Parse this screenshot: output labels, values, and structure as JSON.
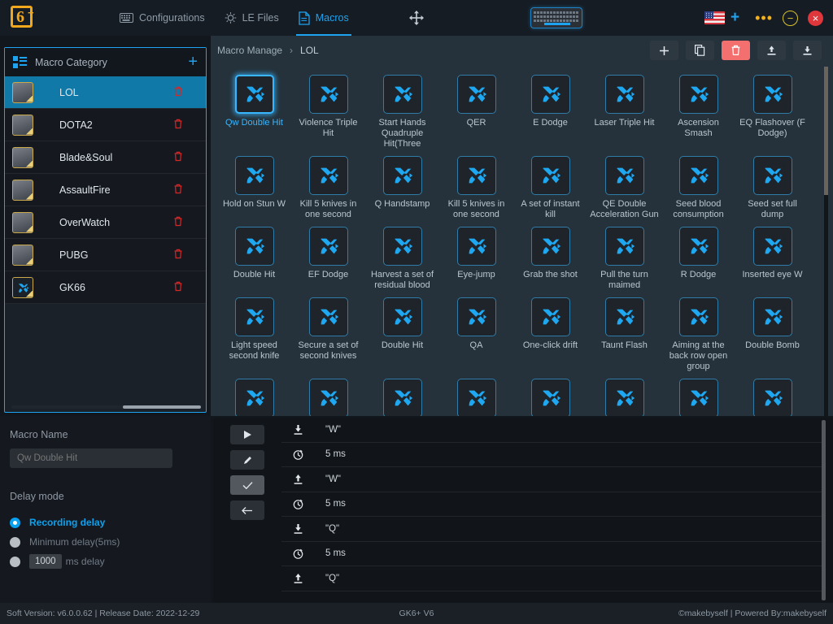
{
  "header": {
    "logo": "6+",
    "nav": [
      {
        "label": "Configurations",
        "icon": "keyboard-icon",
        "active": false
      },
      {
        "label": "LE Files",
        "icon": "lightbulb-icon",
        "active": false
      },
      {
        "label": "Macros",
        "icon": "document-icon",
        "active": true
      }
    ],
    "move_icon": "move-icon",
    "device_icon": "keyboard-device-icon",
    "language_flag": "us-flag-icon",
    "add_language": "+",
    "more_icon": "more-dots-icon",
    "minimize": "−",
    "close": "×",
    "accent_color": "#1ea3f0",
    "logo_color": "#f2a81d"
  },
  "sidebar": {
    "title": "Macro Category",
    "add_label": "+",
    "items": [
      {
        "label": "LOL",
        "selected": true
      },
      {
        "label": "DOTA2",
        "selected": false
      },
      {
        "label": "Blade&Soul",
        "selected": false
      },
      {
        "label": "AssaultFire",
        "selected": false
      },
      {
        "label": "OverWatch",
        "selected": false
      },
      {
        "label": "PUBG",
        "selected": false
      },
      {
        "label": "GK66",
        "selected": false
      }
    ]
  },
  "properties": {
    "macro_name_label": "Macro Name",
    "macro_name_value": "Qw Double Hit",
    "delay_mode_label": "Delay mode",
    "options": [
      {
        "label": "Recording delay",
        "selected": true
      },
      {
        "label": "Minimum delay(5ms)",
        "selected": false
      },
      {
        "label": "ms delay",
        "value": "1000",
        "selected": false
      }
    ]
  },
  "main": {
    "breadcrumb": {
      "root": "Macro Manage",
      "separator": "›",
      "current": "LOL"
    },
    "toolbar": [
      {
        "name": "add-macro-button",
        "glyph": "+",
        "danger": false
      },
      {
        "name": "copy-macro-button",
        "glyph": "❐",
        "danger": false
      },
      {
        "name": "delete-macro-button",
        "glyph": "🗑",
        "danger": true
      },
      {
        "name": "import-macro-button",
        "glyph": "↑",
        "danger": false
      },
      {
        "name": "export-macro-button",
        "glyph": "↓",
        "danger": false
      }
    ],
    "macros": [
      {
        "label": "Qw Double Hit",
        "selected": true
      },
      {
        "label": "Violence Triple Hit",
        "selected": false
      },
      {
        "label": "Start Hands Quadruple Hit(Three",
        "selected": false
      },
      {
        "label": "QER",
        "selected": false
      },
      {
        "label": "E Dodge",
        "selected": false
      },
      {
        "label": "Laser Triple Hit",
        "selected": false
      },
      {
        "label": "Ascension Smash",
        "selected": false
      },
      {
        "label": "EQ Flashover (F Dodge)",
        "selected": false
      },
      {
        "label": "Hold on Stun W",
        "selected": false
      },
      {
        "label": "Kill 5 knives in one second",
        "selected": false
      },
      {
        "label": "Q Handstamp",
        "selected": false
      },
      {
        "label": "Kill 5 knives in one second",
        "selected": false
      },
      {
        "label": "A set of instant kill",
        "selected": false
      },
      {
        "label": "QE Double Acceleration Gun",
        "selected": false
      },
      {
        "label": "Seed blood consumption",
        "selected": false
      },
      {
        "label": "Seed set full dump",
        "selected": false
      },
      {
        "label": "Double Hit",
        "selected": false
      },
      {
        "label": "EF Dodge",
        "selected": false
      },
      {
        "label": "Harvest a set of residual blood",
        "selected": false
      },
      {
        "label": "Eye-jump",
        "selected": false
      },
      {
        "label": "Grab the shot",
        "selected": false
      },
      {
        "label": "Pull the turn maimed",
        "selected": false
      },
      {
        "label": "R Dodge",
        "selected": false
      },
      {
        "label": "Inserted eye W",
        "selected": false
      },
      {
        "label": "Light speed second knife",
        "selected": false
      },
      {
        "label": "Secure a set of second knives",
        "selected": false
      },
      {
        "label": "Double Hit",
        "selected": false
      },
      {
        "label": "QA",
        "selected": false
      },
      {
        "label": "One-click drift",
        "selected": false
      },
      {
        "label": "Taunt Flash",
        "selected": false
      },
      {
        "label": "Aiming at the back row open group",
        "selected": false
      },
      {
        "label": "Double Bomb",
        "selected": false
      },
      {
        "label": "",
        "selected": false
      },
      {
        "label": "",
        "selected": false
      },
      {
        "label": "",
        "selected": false
      },
      {
        "label": "",
        "selected": false
      },
      {
        "label": "",
        "selected": false
      },
      {
        "label": "",
        "selected": false
      },
      {
        "label": "",
        "selected": false
      },
      {
        "label": "",
        "selected": false
      }
    ]
  },
  "actions": {
    "buttons": [
      {
        "name": "play-macro-button",
        "glyph": "▶"
      },
      {
        "name": "edit-macro-button",
        "glyph": "✎"
      },
      {
        "name": "confirm-macro-button",
        "glyph": "✓"
      },
      {
        "name": "back-button",
        "glyph": "←"
      }
    ],
    "rows": [
      {
        "type": "key-down",
        "icon": "key-down-icon",
        "text": "\"W\""
      },
      {
        "type": "delay",
        "icon": "clock-icon",
        "text": "5 ms"
      },
      {
        "type": "key-up",
        "icon": "key-up-icon",
        "text": "\"W\""
      },
      {
        "type": "delay",
        "icon": "clock-icon",
        "text": "5 ms"
      },
      {
        "type": "key-down",
        "icon": "key-down-icon",
        "text": "\"Q\""
      },
      {
        "type": "delay",
        "icon": "clock-icon",
        "text": "5 ms"
      },
      {
        "type": "key-up",
        "icon": "key-up-icon",
        "text": "\"Q\""
      }
    ]
  },
  "footer": {
    "left": "Soft Version: v6.0.0.62 | Release Date: 2022-12-29",
    "center": "GK6+ V6",
    "right": "©makebyself | Powered By:makebyself"
  }
}
